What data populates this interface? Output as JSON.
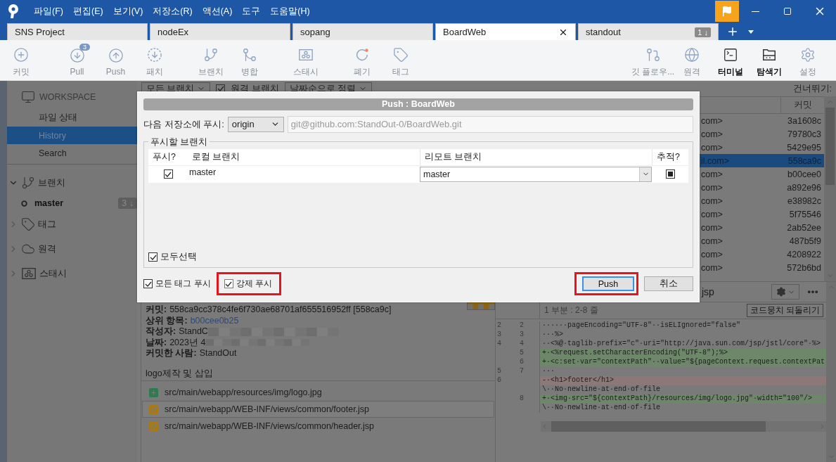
{
  "window": {
    "menu": [
      "파일(F)",
      "편집(E)",
      "보기(V)",
      "저장소(R)",
      "액션(A)",
      "도구",
      "도움말(H)"
    ]
  },
  "tabs": [
    {
      "label": "SNS Project",
      "selected": false
    },
    {
      "label": "nodeEx",
      "selected": false
    },
    {
      "label": "sopang",
      "selected": false
    },
    {
      "label": "BoardWeb",
      "selected": true
    },
    {
      "label": "standout",
      "selected": false,
      "badge": "1 ↓"
    }
  ],
  "toolbar": {
    "left": [
      {
        "kind": "commit",
        "label": "커밋",
        "disabled": true
      },
      {
        "kind": "pull",
        "label": "Pull",
        "disabled": true,
        "badge": "3"
      },
      {
        "kind": "push",
        "label": "Push",
        "disabled": true
      },
      {
        "kind": "patch",
        "label": "패치",
        "disabled": true
      },
      {
        "kind": "branch",
        "label": "브랜치",
        "disabled": true
      },
      {
        "kind": "merge",
        "label": "병합",
        "disabled": true
      },
      {
        "kind": "stash",
        "label": "스태시",
        "disabled": true
      },
      {
        "kind": "discard",
        "label": "폐기",
        "disabled": true
      },
      {
        "kind": "tag",
        "label": "태그",
        "disabled": true
      }
    ],
    "right": [
      {
        "kind": "gitflow",
        "label": "깃 플로우...",
        "disabled": true
      },
      {
        "kind": "remote",
        "label": "원격",
        "disabled": true
      },
      {
        "kind": "terminal",
        "label": "터미널",
        "disabled": false
      },
      {
        "kind": "explorer",
        "label": "탐색기",
        "disabled": false
      },
      {
        "kind": "settings",
        "label": "설정",
        "disabled": true
      }
    ]
  },
  "sidebar": {
    "workspace": {
      "title": "WORKSPACE",
      "items": [
        {
          "label": "파일 상태",
          "selected": false
        },
        {
          "label": "History",
          "selected": true
        },
        {
          "label": "Search",
          "selected": false
        }
      ]
    },
    "sections": [
      {
        "kind": "branches",
        "label": "브랜치",
        "expanded": true,
        "children": [
          {
            "label": "master",
            "badge": "3 ↓"
          }
        ]
      },
      {
        "kind": "tags",
        "label": "태그",
        "expanded": false
      },
      {
        "kind": "remotes",
        "label": "원격",
        "expanded": false
      },
      {
        "kind": "stashes",
        "label": "스태시",
        "expanded": false
      }
    ]
  },
  "filter_bar": {
    "branch_filter": "모든 브랜치",
    "remote_branches": {
      "label": "원격 브랜치",
      "checked": true
    },
    "sort": "날짜순으로 정렬",
    "jump_label": "건너뛰기:"
  },
  "commit_list": {
    "columns": [
      "커밋"
    ],
    "rows": [
      {
        "author": "com>",
        "commit": "3a1608c",
        "selected": false
      },
      {
        "author": "com>",
        "commit": "79780c3",
        "selected": false
      },
      {
        "author": "com>",
        "commit": "5429e95",
        "selected": false
      },
      {
        "author": "il.com>",
        "commit": "558ca9c",
        "selected": true
      },
      {
        "author": "com>",
        "commit": "b00cee0",
        "selected": false
      },
      {
        "author": "com>",
        "commit": "a892e96",
        "selected": false
      },
      {
        "author": "com>",
        "commit": "e38982c",
        "selected": false
      },
      {
        "author": "com>",
        "commit": "5f75546",
        "selected": false
      },
      {
        "author": "com>",
        "commit": "2ab52ee",
        "selected": false
      },
      {
        "author": "com>",
        "commit": "487b5f9",
        "selected": false
      },
      {
        "author": "com>",
        "commit": "4208922",
        "selected": false
      },
      {
        "author": "com>",
        "commit": "572b6bd",
        "selected": false
      }
    ]
  },
  "commit_details": {
    "fields": [
      {
        "label": "커밋:",
        "value": "558ca9cc378c4fe6f730ae68701af655516952ff [558ca9c]",
        "kind": "text"
      },
      {
        "label": "상위 항목:",
        "value": "b00cee0b25",
        "kind": "link"
      },
      {
        "label": "작성자:",
        "value": "StandC",
        "kind": "redacted"
      },
      {
        "label": "날짜:",
        "value": "2023년 4",
        "kind": "redacted"
      },
      {
        "label": "커밋한 사람:",
        "value": "StandOut",
        "kind": "text"
      }
    ],
    "message": "logo제작 및 삽입",
    "files": [
      {
        "path": "src/main/webapp/resources/img/logo.jpg",
        "kind": "added",
        "selected": false
      },
      {
        "path": "src/main/webapp/WEB-INF/views/common/footer.jsp",
        "kind": "modified",
        "selected": true
      },
      {
        "path": "src/main/webapp/WEB-INF/views/common/header.jsp",
        "kind": "modified",
        "selected": false
      }
    ]
  },
  "diff": {
    "file": "jsp",
    "hunk": "1 부분 : 2-8 줄",
    "revert_button": "코드뭉치 되돌리기",
    "lines": [
      {
        "old": "2",
        "new": "2",
        "kind": "context",
        "text": "······pageEncoding=\"UTF-8\"··isELIgnored=\"false\""
      },
      {
        "old": "3",
        "new": "3",
        "kind": "context",
        "text": "···%>"
      },
      {
        "old": "4",
        "new": "4",
        "kind": "context",
        "text": "··<%@·taglib·prefix=\"c\"·uri=\"http://java.sun.com/jsp/jstl/core\"·%>"
      },
      {
        "new": "5",
        "kind": "added",
        "text": "+·<%request.setCharacterEncoding(\"UTF-8\");%>"
      },
      {
        "new": "6",
        "kind": "added",
        "text": "+·<c:set·var=\"contextPath\"··value=\"${pageContext.request.contextPat"
      },
      {
        "old": "5",
        "new": "7",
        "kind": "context",
        "text": "···"
      },
      {
        "old": "6",
        "kind": "removed",
        "text": "-·<h1>footer</h1>"
      },
      {
        "kind": "context",
        "text": "\\··No·newline·at·end·of·file"
      },
      {
        "new": "8",
        "kind": "added",
        "text": "+·<img·src=\"${contextPath}/resources/img/logo.jpg\"·width=\"100\"/>"
      },
      {
        "kind": "context",
        "text": "\\··No·newline·at·end·of·file"
      }
    ]
  },
  "dialog": {
    "title": "Push :  BoardWeb",
    "remote_label": "다음 저장소에 푸시:",
    "remote": "origin",
    "url": "git@github.com:StandOut-0/BoardWeb.git",
    "group_label": "푸시할 브랜치",
    "columns": [
      "푸시?",
      "로컬 브랜치",
      "리모트 브랜치",
      "추적?"
    ],
    "branches": [
      {
        "push": true,
        "local": "master",
        "remote": "master",
        "track": true
      }
    ],
    "select_all": {
      "label": "모두선택",
      "checked": true
    },
    "options": [
      {
        "label": "모든 태그 푸시",
        "checked": true,
        "highlighted": false
      },
      {
        "label": "강제 푸시",
        "checked": true,
        "highlighted": true
      }
    ],
    "buttons": [
      {
        "label": "Push",
        "kind": "primary",
        "highlighted": true
      },
      {
        "label": "취소",
        "kind": "cancel",
        "highlighted": false
      }
    ]
  }
}
